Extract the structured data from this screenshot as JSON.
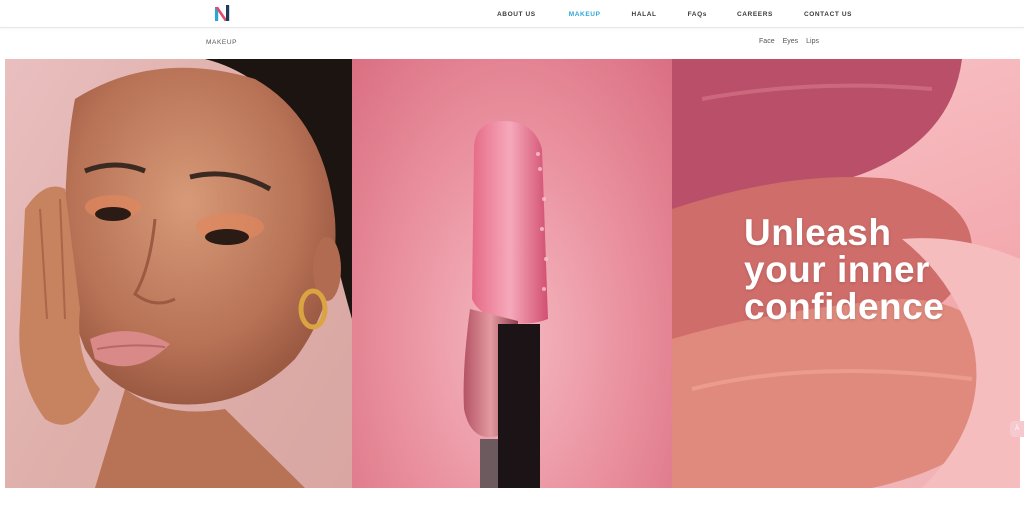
{
  "header": {
    "logo_icon": "n-logo-icon",
    "nav": [
      {
        "label": "ABOUT US",
        "active": false
      },
      {
        "label": "MAKEUP",
        "active": true
      },
      {
        "label": "HALAL",
        "active": false
      },
      {
        "label": "FAQs",
        "active": false
      },
      {
        "label": "CAREERS",
        "active": false
      },
      {
        "label": "CONTACT US",
        "active": false
      }
    ]
  },
  "subbar": {
    "breadcrumb": "MAKEUP",
    "links": [
      "Face",
      "Eyes",
      "Lips"
    ]
  },
  "hero": {
    "headline_lines": [
      "Unleash",
      "your inner",
      "confidence"
    ],
    "panels": [
      "model-portrait-image",
      "lip-gloss-wand-image",
      "lipstick-swatch-image"
    ]
  },
  "side_tab": {
    "label": "À"
  },
  "colors": {
    "accent": "#2aa7d9",
    "nav_text": "#3a3a3a",
    "headline": "#ffffff",
    "hero_pink": "#f3a9ae"
  }
}
